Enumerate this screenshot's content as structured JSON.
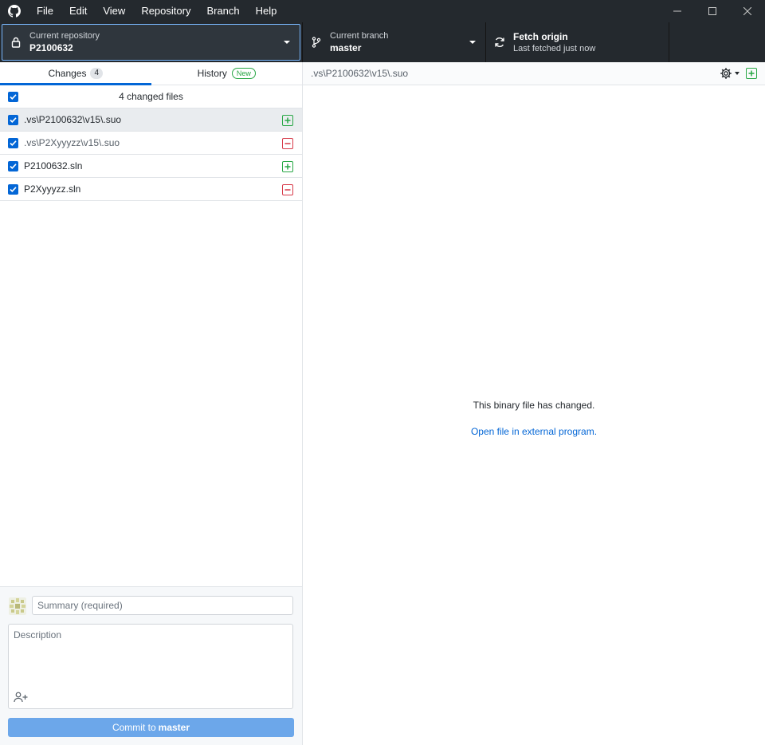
{
  "menu": {
    "items": [
      "File",
      "Edit",
      "View",
      "Repository",
      "Branch",
      "Help"
    ]
  },
  "toolbar": {
    "repo_label": "Current repository",
    "repo_value": "P2100632",
    "branch_label": "Current branch",
    "branch_value": "master",
    "fetch_label": "Fetch origin",
    "fetch_sub": "Last fetched just now"
  },
  "tabs": {
    "changes_label": "Changes",
    "changes_count": "4",
    "history_label": "History",
    "history_badge": "New"
  },
  "changes": {
    "header": "4 changed files",
    "files": [
      {
        "name": ".vs\\P2100632\\v15\\.suo",
        "status": "added",
        "selected": true
      },
      {
        "name": ".vs\\P2Xyyyzz\\v15\\.suo",
        "status": "deleted",
        "selected": false
      },
      {
        "name": "P2100632.sln",
        "status": "added",
        "selected": false
      },
      {
        "name": "P2Xyyyzz.sln",
        "status": "deleted",
        "selected": false
      }
    ]
  },
  "commit": {
    "summary_placeholder": "Summary (required)",
    "description_placeholder": "Description",
    "button_prefix": "Commit to",
    "button_branch": "master"
  },
  "diff": {
    "path": ".vs\\P2100632\\v15\\.suo",
    "message": "This binary file has changed.",
    "link": "Open file in external program."
  },
  "colors": {
    "accent": "#0366d6",
    "added": "#28a745",
    "deleted": "#d73a49",
    "dark_bar": "#24292e"
  }
}
